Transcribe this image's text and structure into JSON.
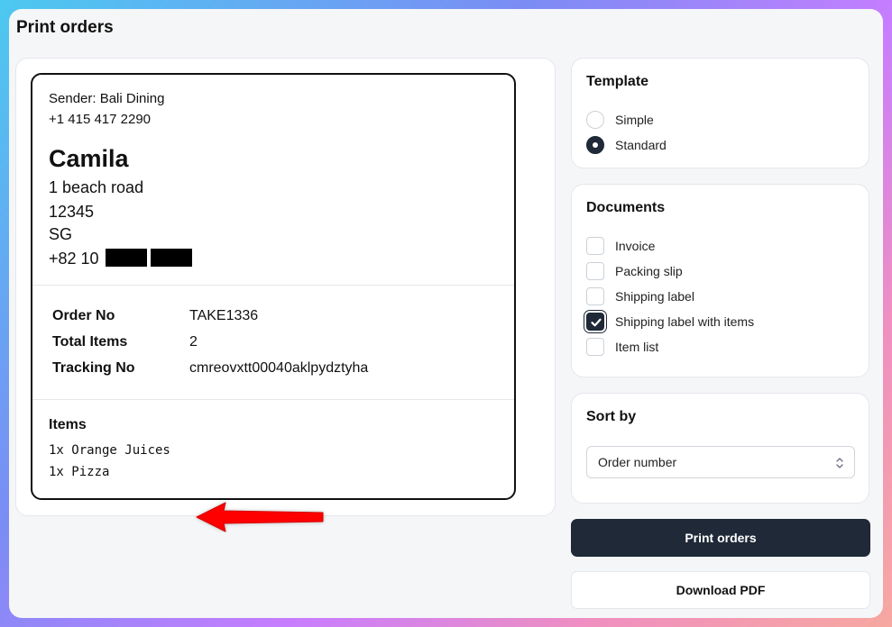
{
  "page": {
    "title": "Print orders"
  },
  "label": {
    "sender": "Sender: Bali Dining",
    "sender_phone": "+1 415 417 2290",
    "recipient_name": "Camila",
    "address_line": "1 beach road",
    "postal_code": "12345",
    "country": "SG",
    "phone_prefix": "+82 10",
    "order_no_label": "Order No",
    "order_no": "TAKE1336",
    "total_items_label": "Total Items",
    "total_items": "2",
    "tracking_no_label": "Tracking No",
    "tracking_no": "cmreovxtt00040aklpydztyha",
    "items_title": "Items",
    "items": [
      "1x Orange Juices",
      "1x Pizza"
    ]
  },
  "template": {
    "title": "Template",
    "options": [
      {
        "label": "Simple",
        "checked": false
      },
      {
        "label": "Standard",
        "checked": true
      }
    ]
  },
  "documents": {
    "title": "Documents",
    "options": [
      {
        "label": "Invoice",
        "checked": false
      },
      {
        "label": "Packing slip",
        "checked": false
      },
      {
        "label": "Shipping label",
        "checked": false
      },
      {
        "label": "Shipping label with items",
        "checked": true
      },
      {
        "label": "Item list",
        "checked": false
      }
    ]
  },
  "sort": {
    "title": "Sort by",
    "selected": "Order number"
  },
  "actions": {
    "print_label": "Print orders",
    "download_label": "Download PDF"
  },
  "colors": {
    "primary": "#1f2937",
    "annotation_arrow": "#ff0000"
  },
  "icons": {
    "arrow": "left-arrow-annotation-icon",
    "check": "check-icon",
    "select": "chevron-up-down-icon"
  }
}
